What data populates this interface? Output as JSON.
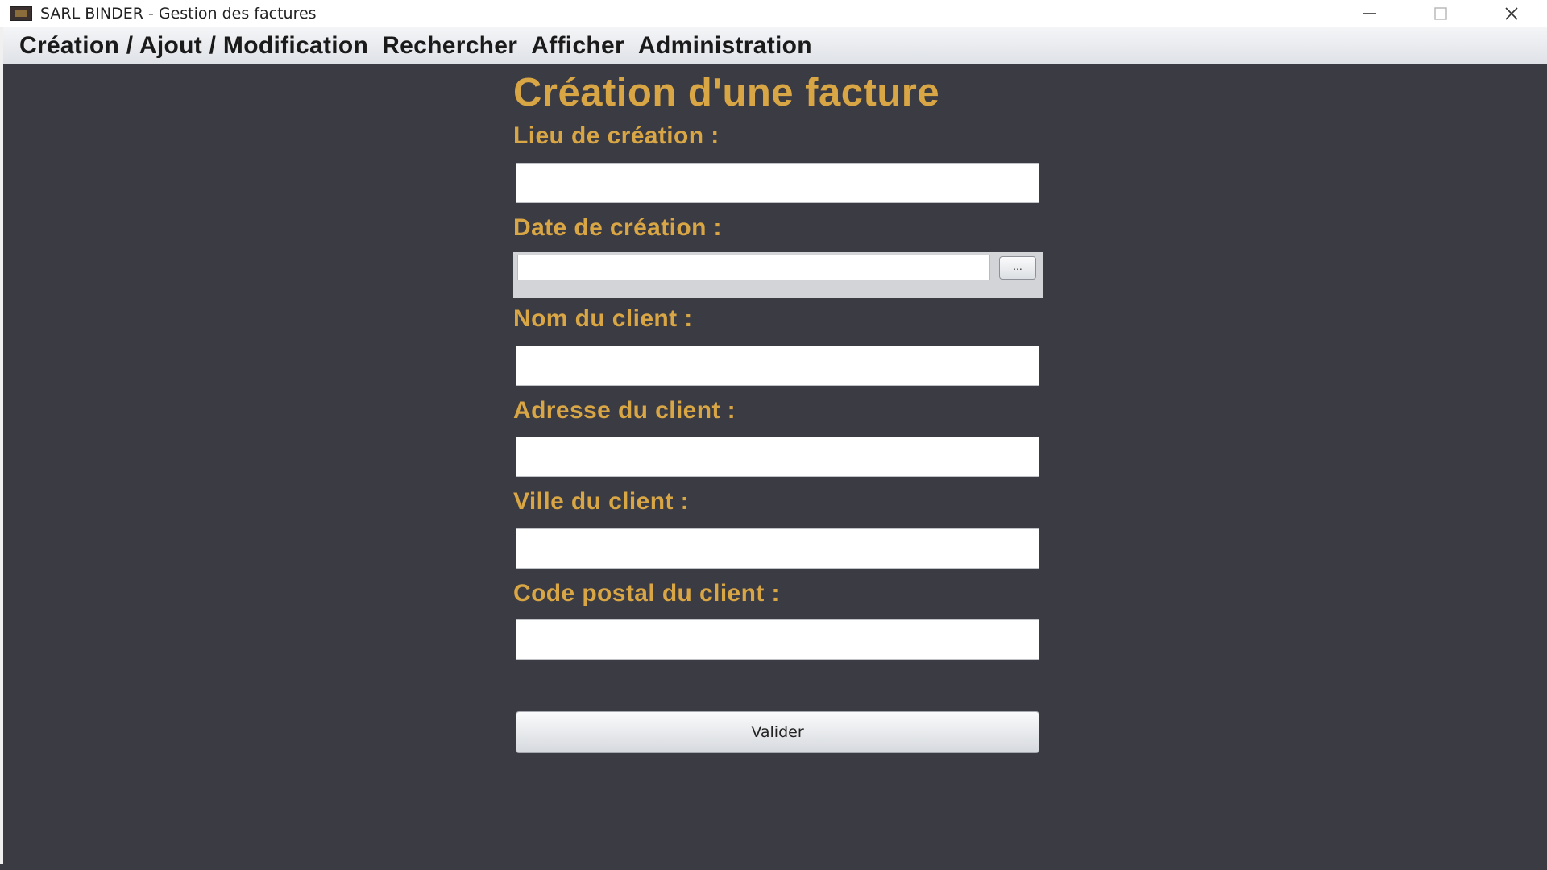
{
  "window": {
    "title": "SARL BINDER - Gestion des factures",
    "icon": "app-logo-icon"
  },
  "menu": {
    "items": [
      {
        "label": "Création / Ajout / Modification"
      },
      {
        "label": "Rechercher"
      },
      {
        "label": "Afficher"
      },
      {
        "label": "Administration"
      }
    ]
  },
  "form": {
    "title": "Création d'une facture",
    "fields": [
      {
        "label": "Lieu de création :",
        "value": "",
        "placeholder": ""
      },
      {
        "label": "Date de création :",
        "value": "",
        "placeholder": "",
        "picker_label": "..."
      },
      {
        "label": "Nom du client :",
        "value": "",
        "placeholder": ""
      },
      {
        "label": "Adresse du client :",
        "value": "",
        "placeholder": ""
      },
      {
        "label": "Ville du client :",
        "value": "",
        "placeholder": ""
      },
      {
        "label": "Code postal du client :",
        "value": "",
        "placeholder": ""
      }
    ],
    "submit_label": "Valider"
  },
  "colors": {
    "background": "#3b3b43",
    "accent": "#d9a645",
    "menubar": "#e6e8ec"
  }
}
